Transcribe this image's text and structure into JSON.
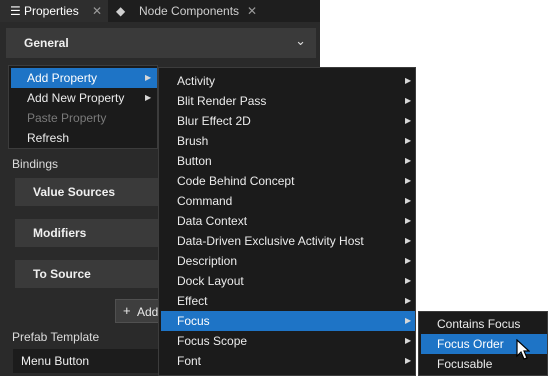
{
  "tabs": [
    {
      "label": "Properties",
      "icon": "list-icon"
    },
    {
      "label": "Node Components",
      "icon": "node-components-icon"
    }
  ],
  "section": {
    "title": "General"
  },
  "bindings": {
    "label": "Bindings",
    "rows": [
      "Value Sources",
      "Modifiers",
      "To Source"
    ],
    "add_label": "Add"
  },
  "prefab": {
    "label": "Prefab Template",
    "value": "Menu Button"
  },
  "context_menu": [
    {
      "label": "Add Property",
      "highlighted": true,
      "submenu": true
    },
    {
      "label": "Add New Property",
      "highlighted": false,
      "submenu": true
    },
    {
      "label": "Paste Property",
      "disabled": true
    },
    {
      "label": "Refresh"
    }
  ],
  "property_menu": [
    "Activity",
    "Blit Render Pass",
    "Blur Effect 2D",
    "Brush",
    "Button",
    "Code Behind Concept",
    "Command",
    "Data Context",
    "Data-Driven Exclusive Activity Host",
    "Description",
    "Dock Layout",
    "Effect",
    "Focus",
    "Focus Scope",
    "Font"
  ],
  "property_menu_highlight": "Focus",
  "focus_menu": [
    "Contains Focus",
    "Focus Order",
    "Focusable"
  ],
  "focus_menu_highlight": "Focus Order",
  "colors": {
    "highlight": "#1e74c6",
    "panel": "#2a2a2a",
    "menu": "#1b1b1b"
  }
}
